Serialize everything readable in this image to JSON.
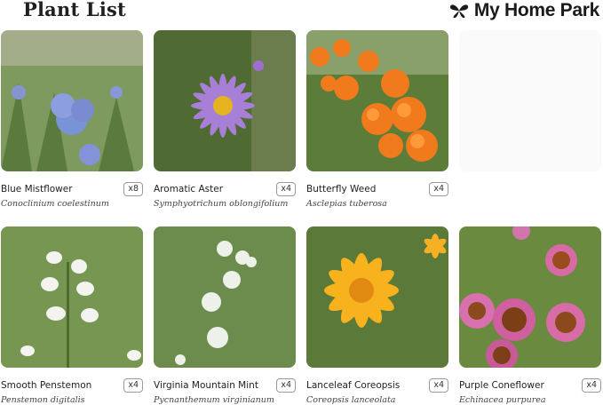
{
  "header": {
    "title": "Plant List",
    "brand": "My Home Park"
  },
  "colors": {
    "brand": "#1a1a1a",
    "tag_border": "#9a9a9a"
  },
  "plants": [
    {
      "common": "Blue Mistflower",
      "scientific": "Conoclinium coelestinum",
      "qty": "x8"
    },
    {
      "common": "Aromatic Aster",
      "scientific": "Symphyotrichum oblongifolium",
      "qty": "x4"
    },
    {
      "common": "Butterfly Weed",
      "scientific": "Asclepias tuberosa",
      "qty": "x4"
    },
    {
      "common": "",
      "scientific": "",
      "qty": ""
    },
    {
      "common": "Smooth Penstemon",
      "scientific": "Penstemon digitalis",
      "qty": "x4"
    },
    {
      "common": "Virginia Mountain Mint",
      "scientific": "Pycnanthemum virginianum",
      "qty": "x4"
    },
    {
      "common": "Lanceleaf Coreopsis",
      "scientific": "Coreopsis lanceolata",
      "qty": "x4"
    },
    {
      "common": "Purple Coneflower",
      "scientific": "Echinacea purpurea",
      "qty": "x4"
    }
  ]
}
